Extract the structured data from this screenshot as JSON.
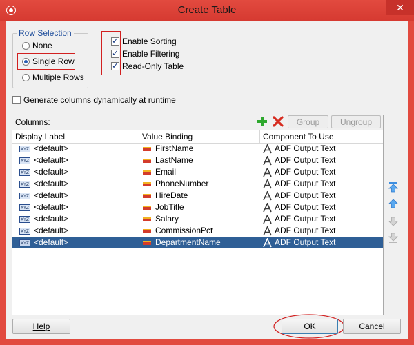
{
  "window": {
    "title": "Create Table",
    "close_glyph": "✕"
  },
  "row_selection": {
    "legend": "Row Selection",
    "options": [
      "None",
      "Single Row",
      "Multiple Rows"
    ],
    "selected": "Single Row"
  },
  "options": {
    "enable_sorting": "Enable Sorting",
    "enable_filtering": "Enable Filtering",
    "read_only_table": "Read-Only Table",
    "generate_columns": "Generate columns dynamically at runtime"
  },
  "columns_panel": {
    "label": "Columns:",
    "add_icon": "green-plus-icon",
    "delete_icon": "red-x-icon",
    "group_label": "Group",
    "ungroup_label": "Ungroup",
    "headers": [
      "Display Label",
      "Value Binding",
      "Component To Use"
    ],
    "rows": [
      {
        "label": "<default>",
        "binding": "FirstName",
        "component": "ADF Output Text"
      },
      {
        "label": "<default>",
        "binding": "LastName",
        "component": "ADF Output Text"
      },
      {
        "label": "<default>",
        "binding": "Email",
        "component": "ADF Output Text"
      },
      {
        "label": "<default>",
        "binding": "PhoneNumber",
        "component": "ADF Output Text"
      },
      {
        "label": "<default>",
        "binding": "HireDate",
        "component": "ADF Output Text"
      },
      {
        "label": "<default>",
        "binding": "JobTitle",
        "component": "ADF Output Text"
      },
      {
        "label": "<default>",
        "binding": "Salary",
        "component": "ADF Output Text"
      },
      {
        "label": "<default>",
        "binding": "CommissionPct",
        "component": "ADF Output Text"
      },
      {
        "label": "<default>",
        "binding": "DepartmentName",
        "component": "ADF Output Text"
      }
    ],
    "selected_row": 8,
    "label_icon_text": "XYZ"
  },
  "footer": {
    "help": "Help",
    "ok": "OK",
    "cancel": "Cancel"
  },
  "colors": {
    "frame": "#e24a3f",
    "selection": "#2f5f96",
    "annotation": "#d22020"
  }
}
